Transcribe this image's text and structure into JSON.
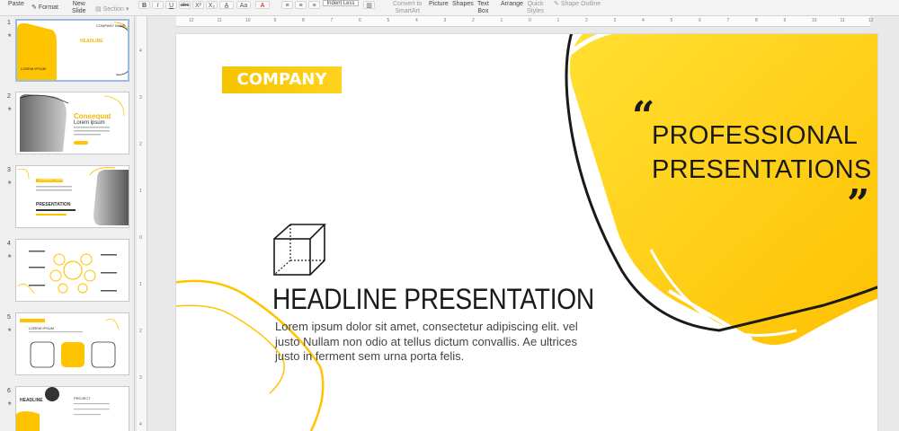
{
  "ribbon": {
    "paste_label": "Paste",
    "format_label": "Format",
    "new_slide_label": "New\nSlide",
    "section_label": "Section",
    "bold": "B",
    "italic": "I",
    "underline": "U",
    "strike": "abc",
    "superscript": "X²",
    "subscript": "X₂",
    "font_color": "A",
    "indent_less_label": "Indent Less",
    "convert_smartart_label": "Convert to\nSmartArt",
    "picture_label": "Picture",
    "shapes_label": "Shapes",
    "textbox_label": "Text\nBox",
    "arrange_label": "Arrange",
    "quick_styles_label": "Quick\nStyles",
    "shape_outline_label": "Shape Outline"
  },
  "thumbnails": {
    "numbers": [
      "1",
      "2",
      "3",
      "4",
      "5",
      "6"
    ],
    "star": "★",
    "t1": {
      "company_name": "COMPANY NAME",
      "headline": "HEADLINE",
      "lorem": "LOREM IPSUM"
    },
    "t2": {
      "title": "Consequat",
      "subtitle": "Lorem ipsum"
    },
    "t3": {
      "company_name": "COMPANY NAME",
      "presentation": "PRESENTATION"
    },
    "t5": {
      "lorem": "LOREM IPSUM"
    },
    "t6": {
      "headline": "HEADLINE",
      "project": "PROJECT"
    }
  },
  "rulers": {
    "h": [
      "12",
      "11",
      "10",
      "9",
      "8",
      "7",
      "6",
      "5",
      "4",
      "3",
      "2",
      "1",
      "0",
      "1",
      "2",
      "3",
      "4",
      "5",
      "6",
      "7",
      "8",
      "9",
      "10",
      "11",
      "12"
    ],
    "v": [
      "4",
      "3",
      "2",
      "1",
      "0",
      "1",
      "2",
      "3",
      "4"
    ]
  },
  "slide": {
    "company": "COMPANY",
    "quote_open": "“",
    "quote_close": "”",
    "professional": "PROFESSIONAL PRESENTATIONS",
    "headline": "HEADLINE PRESENTATION",
    "body": "Lorem ipsum dolor sit amet, consectetur adipiscing elit. vel justo Nullam non odio at tellus dictum convallis. Ae ultrices justo in ferment sem urna porta felis."
  },
  "colors": {
    "accent_yellow": "#ffc400",
    "accent_yellow_light": "#ffe033",
    "ink": "#1a1a1a"
  }
}
